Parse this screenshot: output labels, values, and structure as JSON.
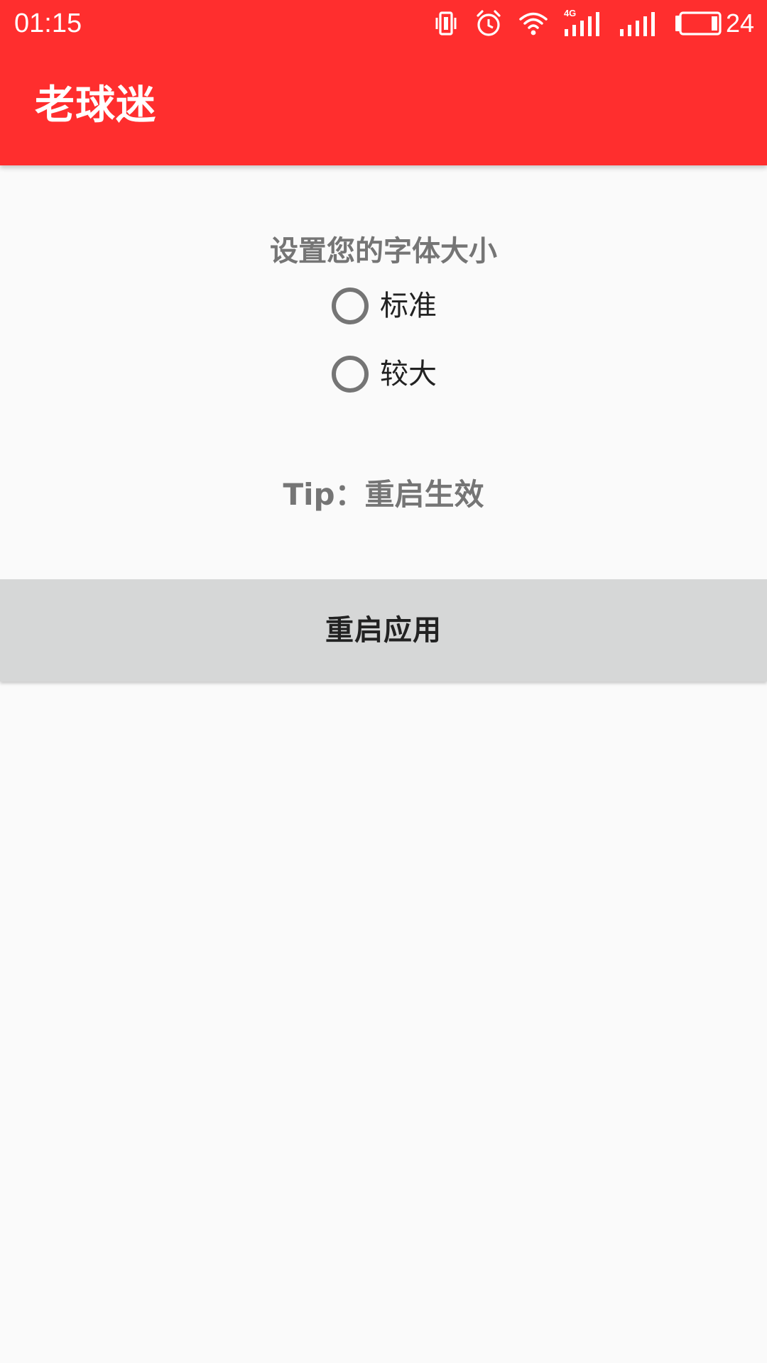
{
  "status_bar": {
    "time": "01:15",
    "network_label": "4G",
    "battery_level": "24",
    "icons": [
      "vibrate-icon",
      "alarm-icon",
      "wifi-icon",
      "signal-4g-icon",
      "signal-icon",
      "battery-icon"
    ]
  },
  "app_bar": {
    "title": "老球迷",
    "color": "#ff2e2e"
  },
  "settings": {
    "title": "设置您的字体大小",
    "options": [
      {
        "label": "标准",
        "selected": false
      },
      {
        "label": "较大",
        "selected": false
      }
    ],
    "tip": "Tip：重启生效",
    "restart_button": "重启应用"
  }
}
